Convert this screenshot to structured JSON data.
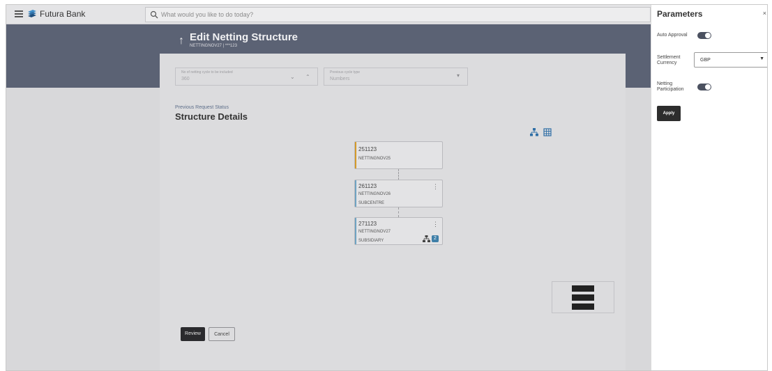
{
  "app": {
    "brand": "Futura Bank"
  },
  "search": {
    "placeholder": "What would you like to do today?"
  },
  "header": {
    "back_icon": "up-arrow-icon",
    "title": "Edit Netting Structure",
    "subtitle": "NETTINGNOV27 | ***123"
  },
  "filters": [
    {
      "label": "No of netting cycle to be included",
      "value": "360"
    },
    {
      "label": "Previous cycle type",
      "value": "Numbers"
    }
  ],
  "section": {
    "previous_status": "Previous Request Status",
    "title": "Structure Details"
  },
  "view_icons": [
    "hierarchy-view-icon",
    "table-view-icon"
  ],
  "nodes": [
    {
      "id": "251123",
      "name": "NETTINGNOV25",
      "type": "",
      "accent": "#d49a2a",
      "has_menu": false
    },
    {
      "id": "261123",
      "name": "NETTINGNOV26",
      "type": "SUBCENTRE",
      "accent": "#6fa3c2",
      "has_menu": true
    },
    {
      "id": "271123",
      "name": "NETTINGNOV27",
      "type": "SUBSIDIARY",
      "accent": "#6fa3c2",
      "has_menu": true,
      "children_count": "2"
    }
  ],
  "buttons": {
    "review": "Review",
    "cancel": "Cancel"
  },
  "panel": {
    "title": "Parameters",
    "auto_approval": {
      "label": "Auto Approval",
      "enabled": true
    },
    "settlement_currency": {
      "label_line1": "Settlement",
      "label_line2": "Currency",
      "value": "GBP"
    },
    "netting_participation": {
      "label_line1": "Netting",
      "label_line2": "Participation",
      "enabled": true
    },
    "apply": "Apply"
  },
  "colors": {
    "banner": "#5b6274",
    "accent_primary": "#d49a2a",
    "accent_secondary": "#6fa3c2",
    "dark_button": "#2d2d2d"
  }
}
